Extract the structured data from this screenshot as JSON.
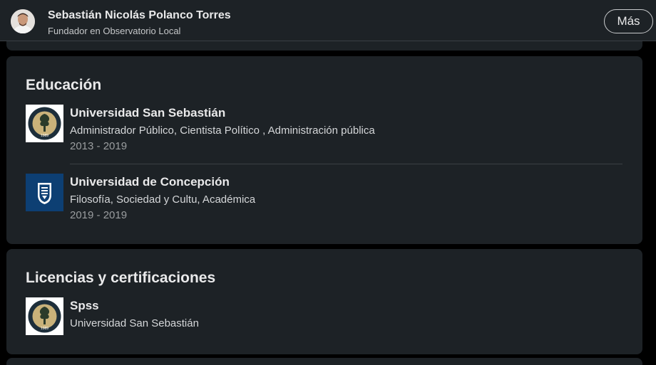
{
  "header": {
    "name": "Sebastián Nicolás Polanco Torres",
    "headline": "Fundador en Observatorio Local",
    "more_label": "Más"
  },
  "education": {
    "title": "Educación",
    "items": [
      {
        "school": "Universidad San Sebastián",
        "degree": "Administrador Público, Cientista Político , Administración pública",
        "dates": "2013 - 2019",
        "logo": "uss-seal-logo",
        "seal_text": "1989"
      },
      {
        "school": "Universidad de Concepción",
        "degree": "Filosofía, Sociedad y Cultu, Académica",
        "dates": "2019 - 2019",
        "logo": "udec-shield-logo"
      }
    ]
  },
  "certifications": {
    "title": "Licencias y certificaciones",
    "items": [
      {
        "name": "Spss",
        "issuer": "Universidad San Sebastián",
        "logo": "uss-seal-logo",
        "seal_text": "1989"
      }
    ]
  },
  "colors": {
    "background": "#000000",
    "card": "#1d2226",
    "text": "#e9e9ea",
    "muted": "#9a9d9f",
    "udec_blue": "#0d3f73",
    "uss_gold": "#c9b27a"
  }
}
